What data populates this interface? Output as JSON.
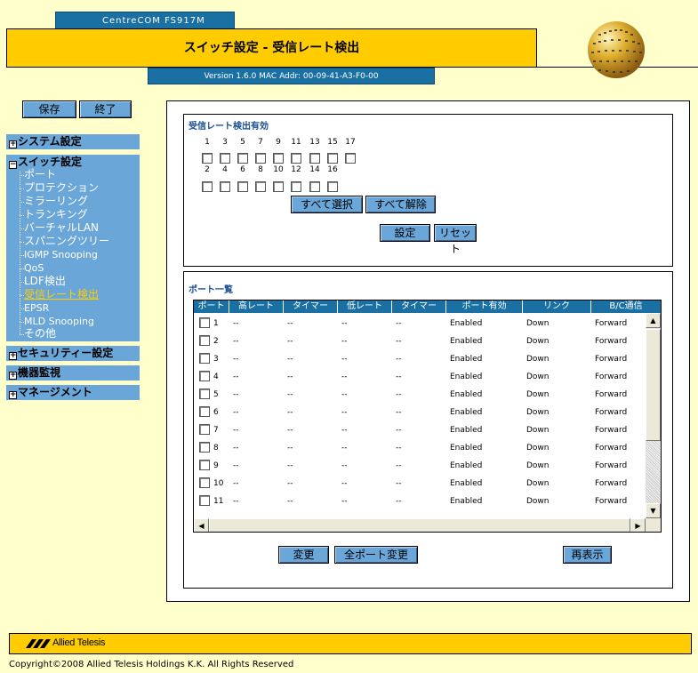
{
  "header": {
    "product": "CentreCOM FS917M",
    "title": "スイッチ設定 - 受信レート検出",
    "version": "Version 1.6.0 MAC Addr: 00-09-41-A3-F0-00"
  },
  "nav": {
    "save": "保存",
    "exit": "終了",
    "system": "システム設定",
    "switch": "スイッチ設定",
    "switch_items": [
      "ポート",
      "プロテクション",
      "ミラーリング",
      "トランキング",
      "バーチャルLAN",
      "スパニングツリー",
      "IGMP Snooping",
      "QoS",
      "LDF検出",
      "受信レート検出",
      "EPSR",
      "MLD Snooping",
      "その他"
    ],
    "security": "セキュリティー設定",
    "monitor": "機器監視",
    "management": "マネージメント",
    "box_plus": "+",
    "box_minus": "−"
  },
  "rate": {
    "title": "受信レート検出有効",
    "odd_ports": [
      "1",
      "3",
      "5",
      "7",
      "9",
      "11",
      "13",
      "15",
      "17"
    ],
    "even_ports": [
      "2",
      "4",
      "6",
      "8",
      "10",
      "12",
      "14",
      "16"
    ],
    "select_all": "すべて選択",
    "clear_all": "すべて解除",
    "set": "設定",
    "reset": "リセット"
  },
  "ports": {
    "title": "ポート一覧",
    "headers": [
      "ポート",
      "高レート",
      "タイマー",
      "低レート",
      "タイマー",
      "ポート有効",
      "リンク",
      "B/C通信"
    ],
    "rows": [
      {
        "port": "1",
        "high": "--",
        "timer1": "--",
        "low": "--",
        "timer2": "--",
        "enabled": "Enabled",
        "link": "Down",
        "bc": "Forward"
      },
      {
        "port": "2",
        "high": "--",
        "timer1": "--",
        "low": "--",
        "timer2": "--",
        "enabled": "Enabled",
        "link": "Down",
        "bc": "Forward"
      },
      {
        "port": "3",
        "high": "--",
        "timer1": "--",
        "low": "--",
        "timer2": "--",
        "enabled": "Enabled",
        "link": "Down",
        "bc": "Forward"
      },
      {
        "port": "4",
        "high": "--",
        "timer1": "--",
        "low": "--",
        "timer2": "--",
        "enabled": "Enabled",
        "link": "Down",
        "bc": "Forward"
      },
      {
        "port": "5",
        "high": "--",
        "timer1": "--",
        "low": "--",
        "timer2": "--",
        "enabled": "Enabled",
        "link": "Down",
        "bc": "Forward"
      },
      {
        "port": "6",
        "high": "--",
        "timer1": "--",
        "low": "--",
        "timer2": "--",
        "enabled": "Enabled",
        "link": "Down",
        "bc": "Forward"
      },
      {
        "port": "7",
        "high": "--",
        "timer1": "--",
        "low": "--",
        "timer2": "--",
        "enabled": "Enabled",
        "link": "Down",
        "bc": "Forward"
      },
      {
        "port": "8",
        "high": "--",
        "timer1": "--",
        "low": "--",
        "timer2": "--",
        "enabled": "Enabled",
        "link": "Down",
        "bc": "Forward"
      },
      {
        "port": "9",
        "high": "--",
        "timer1": "--",
        "low": "--",
        "timer2": "--",
        "enabled": "Enabled",
        "link": "Down",
        "bc": "Forward"
      },
      {
        "port": "10",
        "high": "--",
        "timer1": "--",
        "low": "--",
        "timer2": "--",
        "enabled": "Enabled",
        "link": "Down",
        "bc": "Forward"
      },
      {
        "port": "11",
        "high": "--",
        "timer1": "--",
        "low": "--",
        "timer2": "--",
        "enabled": "Enabled",
        "link": "Down",
        "bc": "Forward"
      }
    ],
    "change": "変更",
    "change_all": "全ポート変更",
    "refresh": "再表示"
  },
  "footer": {
    "brand": "Allied Telesis",
    "copyright": "Copyright©2008 Allied Telesis Holdings K.K. All Rights Reserved"
  },
  "colors": {
    "page_bg": "#ffffcc",
    "accent_yellow": "#ffcc00",
    "accent_blue": "#1a6fa3",
    "nav_blue": "#6aa6d8"
  }
}
